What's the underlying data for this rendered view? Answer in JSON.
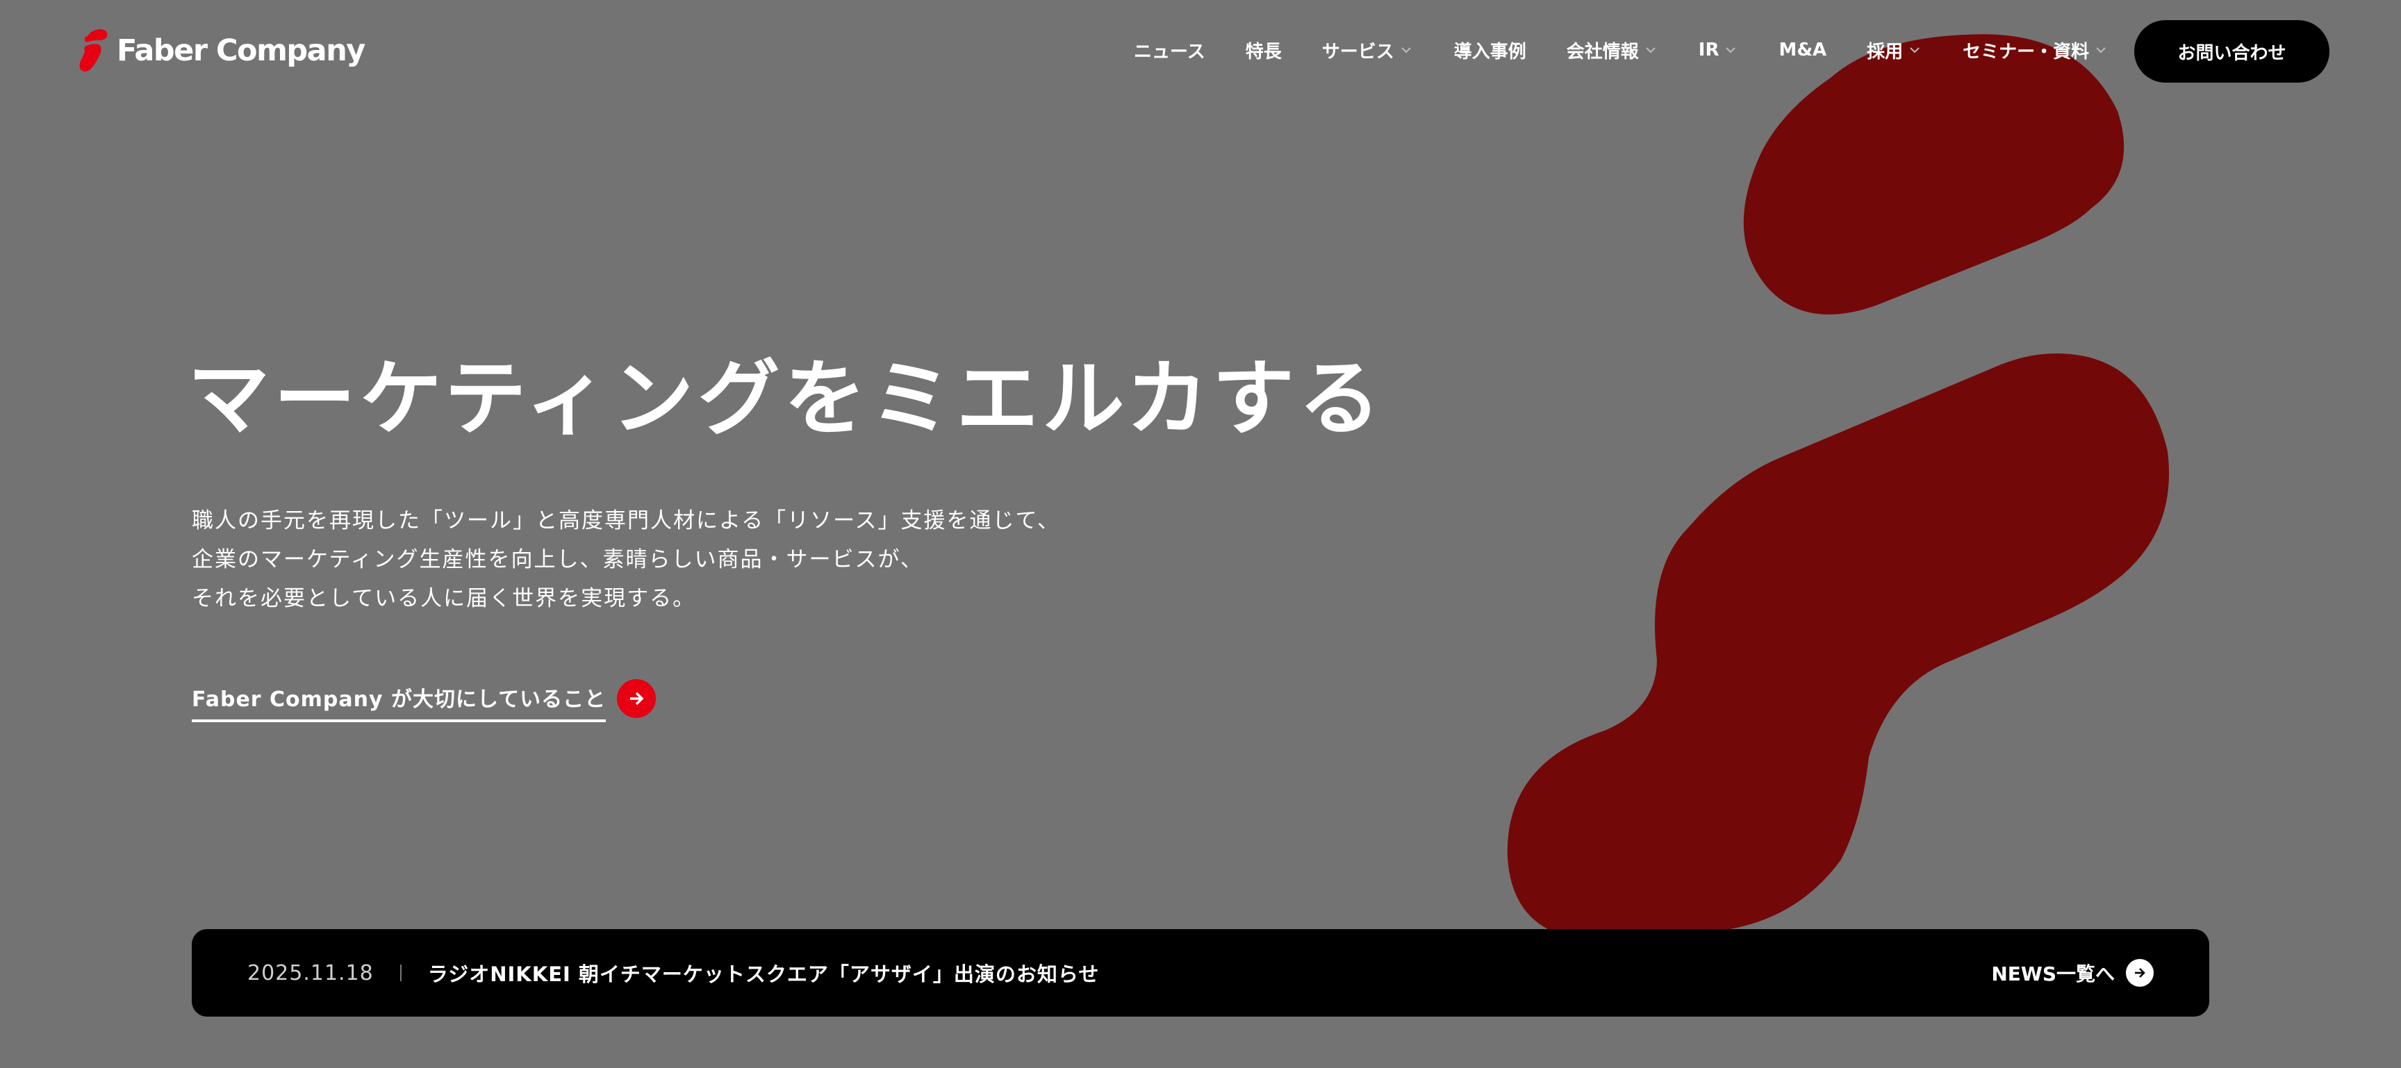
{
  "brand": {
    "name": "Faber Company",
    "accent_color": "#e60012",
    "shape_color": "#730808",
    "background_color": "#737373"
  },
  "header": {
    "nav": [
      {
        "label": "ニュース",
        "has_dropdown": false
      },
      {
        "label": "特長",
        "has_dropdown": false
      },
      {
        "label": "サービス",
        "has_dropdown": true
      },
      {
        "label": "導入事例",
        "has_dropdown": false
      },
      {
        "label": "会社情報",
        "has_dropdown": true
      },
      {
        "label": "IR",
        "has_dropdown": true
      },
      {
        "label": "M&A",
        "has_dropdown": false
      },
      {
        "label": "採用",
        "has_dropdown": true
      },
      {
        "label": "セミナー・資料",
        "has_dropdown": true
      }
    ],
    "contact_label": "お問い合わせ"
  },
  "hero": {
    "title": "マーケティングをミエルカする",
    "description": [
      "職人の手元を再現した「ツール」と高度専門人材による「リソース」支援を通じて、",
      "企業のマーケティング生産性を向上し、素晴らしい商品・サービスが、",
      "それを必要としている人に届く世界を実現する。"
    ],
    "link_label": "Faber Company が大切にしていること",
    "link_icon": "arrow-right-icon"
  },
  "news": {
    "date": "2025.11.18",
    "title": "ラジオNIKKEI 朝イチマーケットスクエア「アサザイ」出演のお知らせ",
    "all_label": "NEWS一覧へ",
    "all_icon": "arrow-right-icon"
  }
}
